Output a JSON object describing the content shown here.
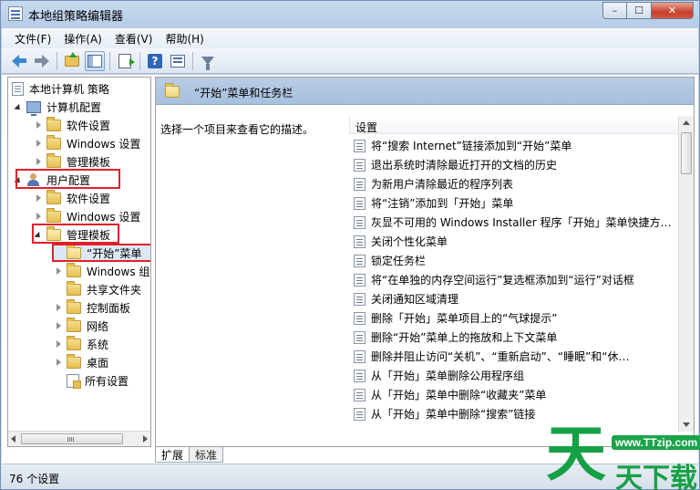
{
  "window": {
    "title": "本地组策略编辑器",
    "min_glyph": "–",
    "max_glyph": "☐",
    "close_glyph": "✕"
  },
  "menu": [
    "文件(F)",
    "操作(A)",
    "查看(V)",
    "帮助(H)"
  ],
  "toolbar_icons": [
    "back-arrow-icon",
    "forward-arrow-icon",
    "folder-up-icon",
    "show-hide-tree-icon",
    "export-list-icon",
    "help-icon",
    "properties-icon",
    "filter-icon"
  ],
  "tree": {
    "root": "本地计算机 策略",
    "computer_config": "计算机配置",
    "cc_software": "软件设置",
    "cc_windows": "Windows 设置",
    "cc_admin": "管理模板",
    "user_config": "用户配置",
    "uc_software": "软件设置",
    "uc_windows": "Windows 设置",
    "uc_admin": "管理模板",
    "start_menu": "“开始”菜单",
    "windows_components": "Windows 组",
    "shared_folders": "共享文件夹",
    "control_panel": "控制面板",
    "network": "网络",
    "system": "系统",
    "desktop": "桌面",
    "all_settings": "所有设置"
  },
  "right": {
    "header_title": "“开始”菜单和任务栏",
    "description": "选择一个项目来查看它的描述。",
    "column_header": "设置",
    "items": [
      "将“搜索 Internet”链接添加到“开始”菜单",
      "退出系统时清除最近打开的文档的历史",
      "为新用户清除最近的程序列表",
      "将“注销”添加到「开始」菜单",
      "灰显不可用的 Windows Installer 程序「开始」菜单快捷方…",
      "关闭个性化菜单",
      "锁定任务栏",
      "将“在单独的内存空间运行”复选框添加到“运行”对话框",
      "关闭通知区域清理",
      "删除「开始」菜单项目上的“气球提示”",
      "删除“开始”菜单上的拖放和上下文菜单",
      "删除并阻止访问“关机”、“重新启动”、“睡眠”和“休…",
      "从「开始」菜单删除公用程序组",
      "从「开始」菜单中删除“收藏夹”菜单",
      "从「开始」菜单中删除“搜索”链接"
    ]
  },
  "tabs": [
    "扩展",
    "标准"
  ],
  "status": "76 个设置",
  "watermark": {
    "url": "www.TTzip.com",
    "big": "天",
    "sub": "天下载"
  },
  "colors": {
    "highlight_box": "#e0202a",
    "header_blue": "#a6c0de",
    "watermark_green": "#16a046"
  }
}
